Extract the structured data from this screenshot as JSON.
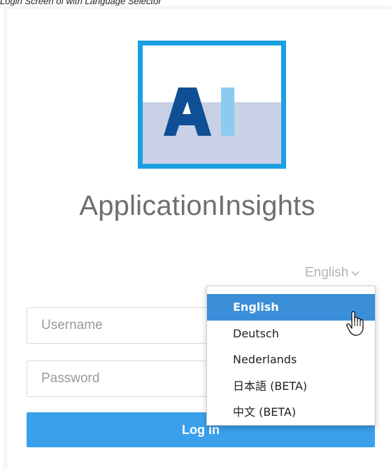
{
  "caption": "Login Screen of with Language Selector",
  "logo": {
    "text": "AI",
    "colors": {
      "border": "#1aa0e0",
      "letter_a": "#0f4f95",
      "letter_i": "#8ccbef",
      "band": "#c8d1e6"
    }
  },
  "app_title": "ApplicationInsights",
  "language": {
    "current": "English",
    "options": [
      {
        "label": "English",
        "selected": true
      },
      {
        "label": "Deutsch",
        "selected": false
      },
      {
        "label": "Nederlands",
        "selected": false
      },
      {
        "label": "日本語 (BETA)",
        "selected": false
      },
      {
        "label": "中文 (BETA)",
        "selected": false
      }
    ]
  },
  "form": {
    "username_placeholder": "Username",
    "password_placeholder": "Password",
    "login_label": "Log in"
  },
  "colors": {
    "accent": "#3aa0ec",
    "dropdown_highlight": "#3b8fd9"
  },
  "icons": {
    "language_trigger": "chevron-down-icon",
    "pointer": "hand-pointer-icon"
  }
}
